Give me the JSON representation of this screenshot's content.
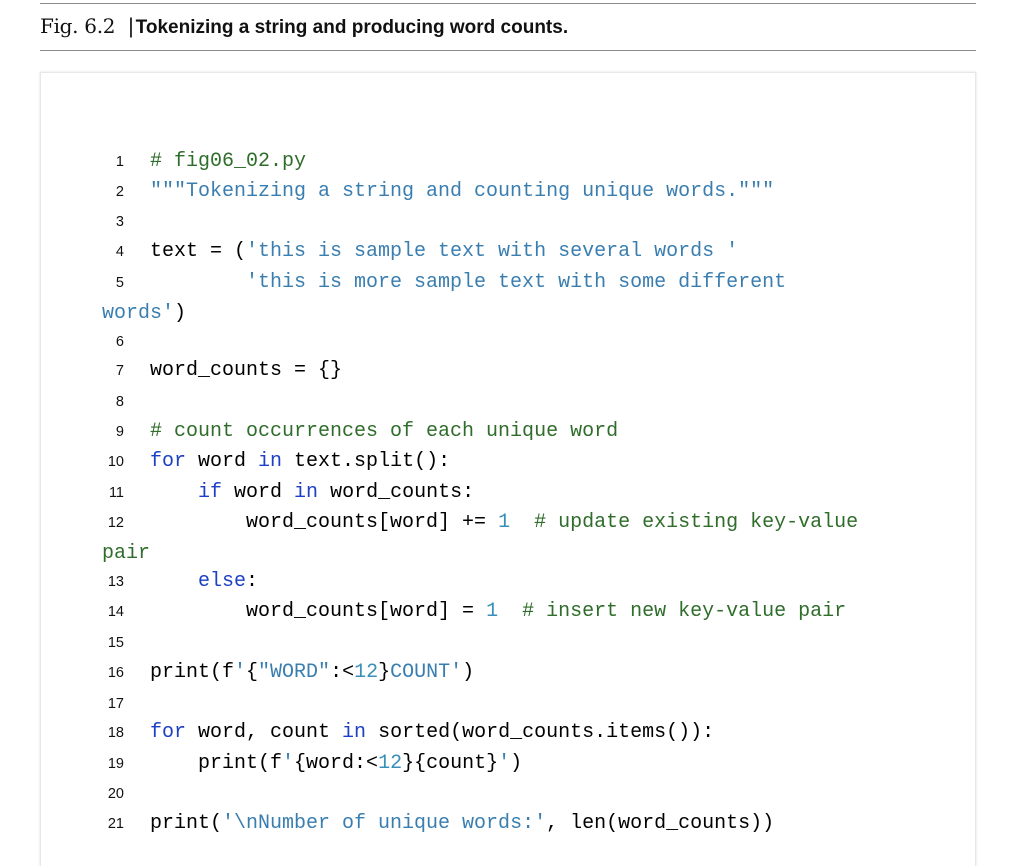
{
  "caption": {
    "figure_number": "Fig. 6.2",
    "separator": "|",
    "title": "Tokenizing a string and producing word counts."
  },
  "code": {
    "lines": [
      {
        "n": "1",
        "tokens": [
          {
            "t": "# fig06_02.py",
            "c": "cm"
          }
        ]
      },
      {
        "n": "2",
        "tokens": [
          {
            "t": "\"\"\"Tokenizing a string and counting unique words.\"\"\"",
            "c": "str"
          }
        ]
      },
      {
        "n": "3",
        "tokens": []
      },
      {
        "n": "4",
        "tokens": [
          {
            "t": "text = (",
            "c": ""
          },
          {
            "t": "'this is sample text with several words '",
            "c": "str"
          }
        ]
      },
      {
        "n": "5",
        "tokens": [
          {
            "t": "        ",
            "c": ""
          },
          {
            "t": "'this is more sample text with some different",
            "c": "str"
          }
        ],
        "wrap": [
          {
            "t": "words'",
            "c": "str"
          },
          {
            "t": ")",
            "c": ""
          }
        ]
      },
      {
        "n": "6",
        "tokens": []
      },
      {
        "n": "7",
        "tokens": [
          {
            "t": "word_counts = {}",
            "c": ""
          }
        ]
      },
      {
        "n": "8",
        "tokens": []
      },
      {
        "n": "9",
        "tokens": [
          {
            "t": "# count occurrences of each unique word",
            "c": "cm"
          }
        ]
      },
      {
        "n": "10",
        "tokens": [
          {
            "t": "for",
            "c": "kw"
          },
          {
            "t": " word ",
            "c": ""
          },
          {
            "t": "in",
            "c": "kw"
          },
          {
            "t": " text.split():",
            "c": ""
          }
        ]
      },
      {
        "n": "11",
        "tokens": [
          {
            "t": "    ",
            "c": ""
          },
          {
            "t": "if",
            "c": "kw"
          },
          {
            "t": " word ",
            "c": ""
          },
          {
            "t": "in",
            "c": "kw"
          },
          {
            "t": " word_counts:",
            "c": ""
          }
        ]
      },
      {
        "n": "12",
        "tokens": [
          {
            "t": "        word_counts[word] += ",
            "c": ""
          },
          {
            "t": "1",
            "c": "num"
          },
          {
            "t": "  ",
            "c": ""
          },
          {
            "t": "# update existing key-value",
            "c": "cm"
          }
        ],
        "wrap": [
          {
            "t": "pair",
            "c": "cm"
          }
        ]
      },
      {
        "n": "13",
        "tokens": [
          {
            "t": "    ",
            "c": ""
          },
          {
            "t": "else",
            "c": "kw"
          },
          {
            "t": ":",
            "c": ""
          }
        ]
      },
      {
        "n": "14",
        "tokens": [
          {
            "t": "        word_counts[word] = ",
            "c": ""
          },
          {
            "t": "1",
            "c": "num"
          },
          {
            "t": "  ",
            "c": ""
          },
          {
            "t": "# insert new key-value pair",
            "c": "cm"
          }
        ]
      },
      {
        "n": "15",
        "tokens": []
      },
      {
        "n": "16",
        "tokens": [
          {
            "t": "print(f",
            "c": ""
          },
          {
            "t": "'",
            "c": "str"
          },
          {
            "t": "{",
            "c": ""
          },
          {
            "t": "\"WORD\"",
            "c": "str"
          },
          {
            "t": ":<",
            "c": ""
          },
          {
            "t": "12",
            "c": "num"
          },
          {
            "t": "}",
            "c": ""
          },
          {
            "t": "COUNT'",
            "c": "str"
          },
          {
            "t": ")",
            "c": ""
          }
        ]
      },
      {
        "n": "17",
        "tokens": []
      },
      {
        "n": "18",
        "tokens": [
          {
            "t": "for",
            "c": "kw"
          },
          {
            "t": " word, count ",
            "c": ""
          },
          {
            "t": "in",
            "c": "kw"
          },
          {
            "t": " sorted(word_counts.items()):",
            "c": ""
          }
        ]
      },
      {
        "n": "19",
        "tokens": [
          {
            "t": "    print(f",
            "c": ""
          },
          {
            "t": "'",
            "c": "str"
          },
          {
            "t": "{word:<",
            "c": ""
          },
          {
            "t": "12",
            "c": "num"
          },
          {
            "t": "}{count}",
            "c": ""
          },
          {
            "t": "'",
            "c": "str"
          },
          {
            "t": ")",
            "c": ""
          }
        ]
      },
      {
        "n": "20",
        "tokens": []
      },
      {
        "n": "21",
        "tokens": [
          {
            "t": "print(",
            "c": ""
          },
          {
            "t": "'\\nNumber of unique words:'",
            "c": "str"
          },
          {
            "t": ", len(word_counts))",
            "c": ""
          }
        ]
      }
    ]
  }
}
